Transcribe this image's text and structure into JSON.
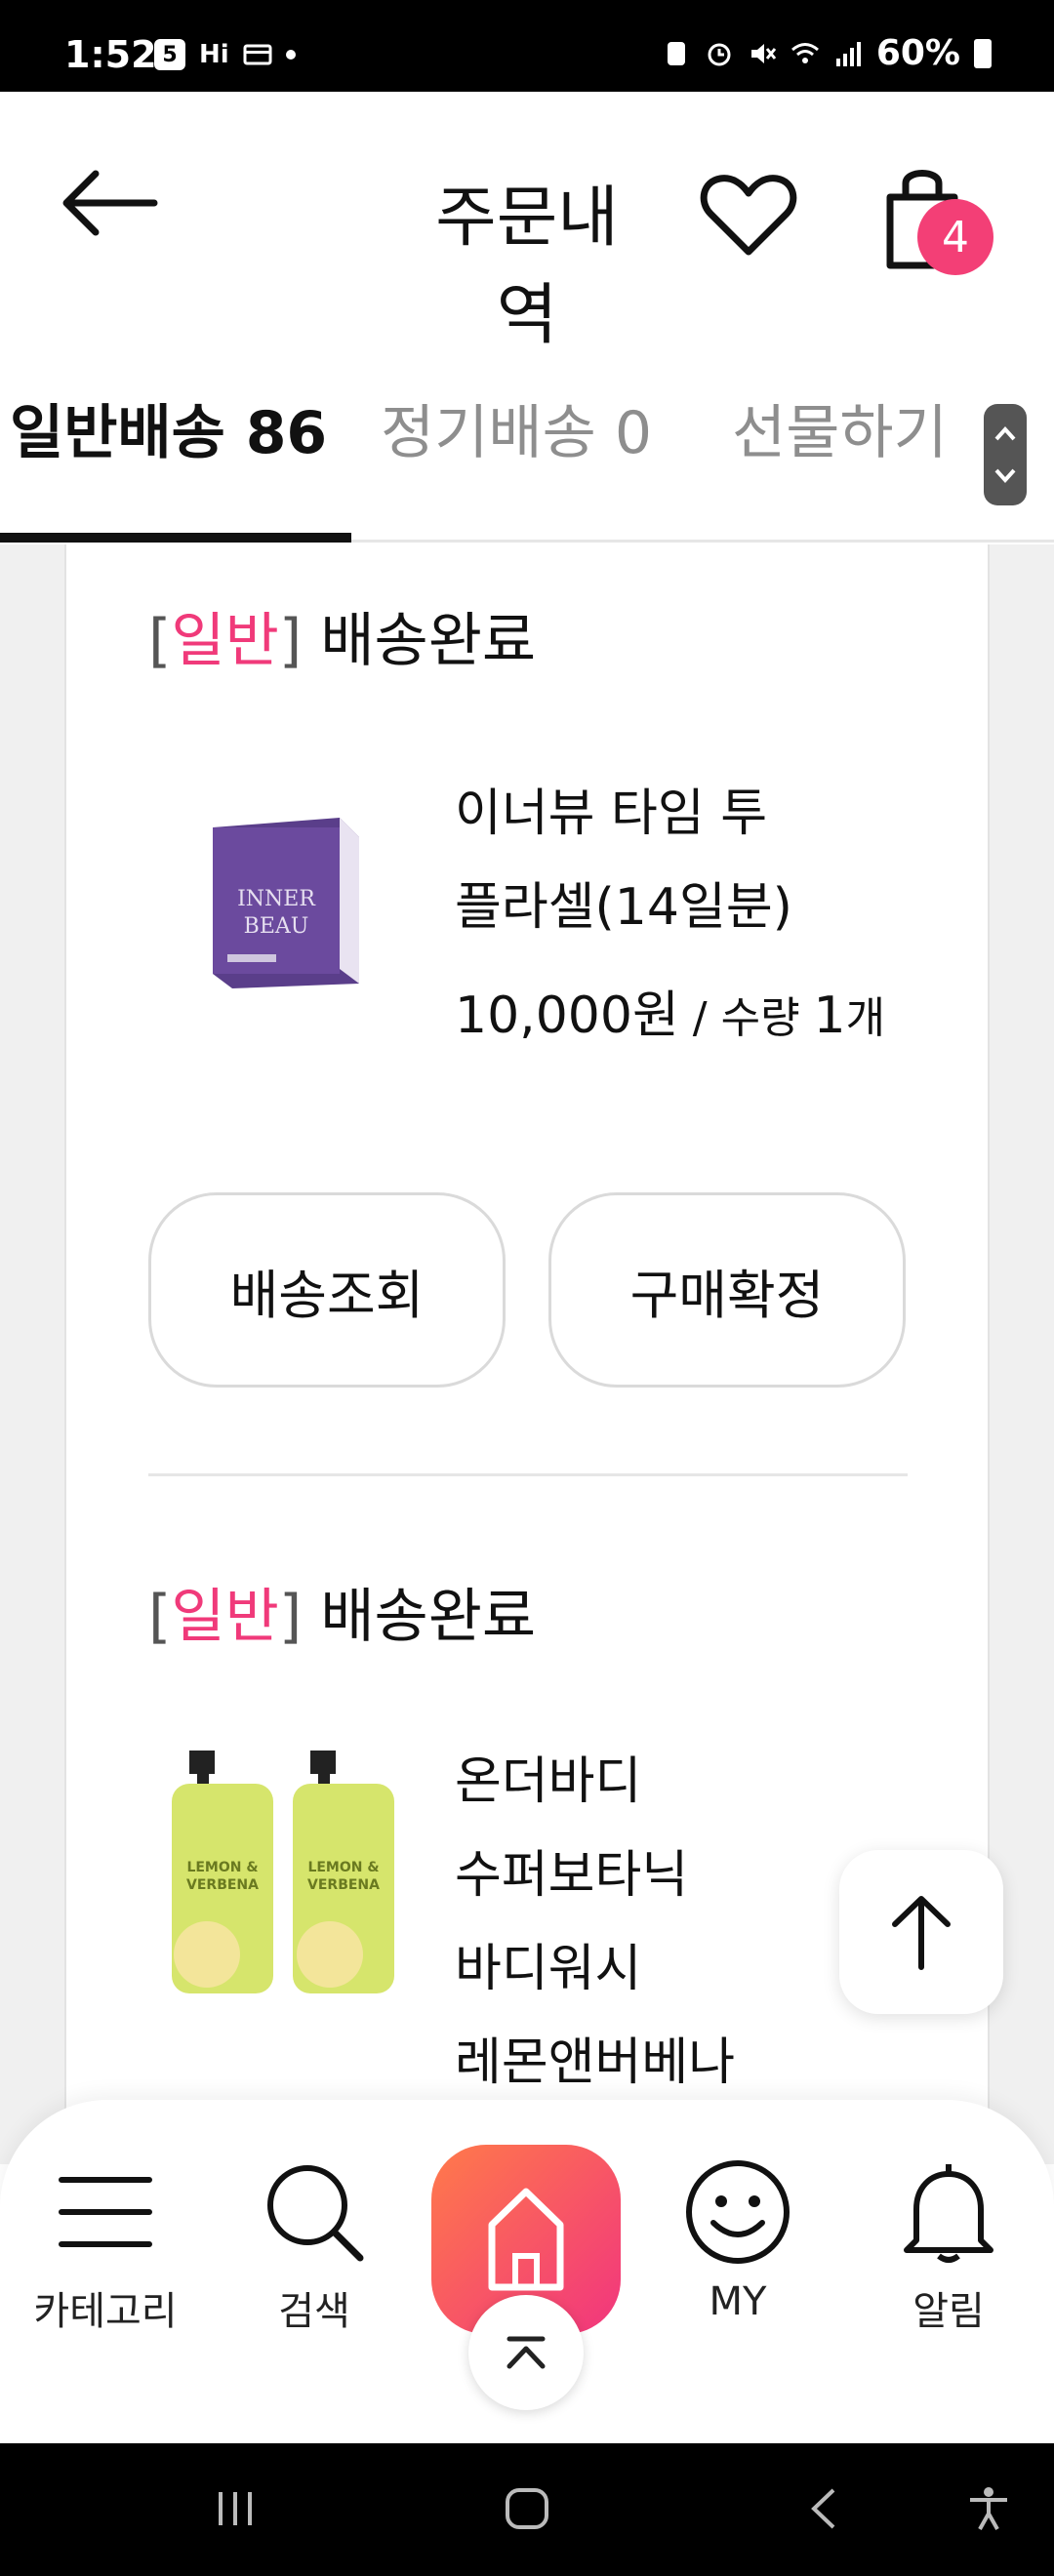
{
  "status_bar": {
    "time": "1:52",
    "badge_s": "5",
    "hi_text": "Hi",
    "battery": "60%"
  },
  "header": {
    "title": "주문내역",
    "cart_count": "4"
  },
  "tabs": [
    {
      "label": "일반배송 86",
      "active": true
    },
    {
      "label": "정기배송 0",
      "active": false
    },
    {
      "label": "선물하기",
      "active": false
    }
  ],
  "orders": [
    {
      "bracket_open": "[",
      "type": "일반",
      "bracket_close": "]",
      "status": " 배송완료",
      "product_name_line1": "이너뷰 타임 투",
      "product_name_line2": "플라셀(14일분)",
      "price": "10,000원",
      "qty_label": " / 수량 ",
      "qty_value": "1",
      "qty_unit": "개",
      "buttons": [
        "배송조회",
        "구매확정"
      ],
      "image_text_1": "INNER",
      "image_text_2": "BEAU"
    },
    {
      "bracket_open": "[",
      "type": "일반",
      "bracket_close": "]",
      "status": " 배송완료",
      "product_name_lines": [
        "온더바디",
        "수퍼보타닉",
        "바디워시",
        "레몬앤버베나"
      ],
      "image_text_1": "LEMON &",
      "image_text_2": "VERBENA"
    }
  ],
  "bottom_nav": {
    "items": [
      {
        "label": "카테고리",
        "icon": "menu-icon"
      },
      {
        "label": "검색",
        "icon": "search-icon"
      },
      {
        "label": "MY",
        "icon": "smiley-icon"
      },
      {
        "label": "알림",
        "icon": "bell-icon"
      }
    ]
  },
  "colors": {
    "accent": "#f03a7a",
    "badge": "#f33f76",
    "home_gradient_start": "#ff7a4a",
    "home_gradient_end": "#f1357e"
  }
}
